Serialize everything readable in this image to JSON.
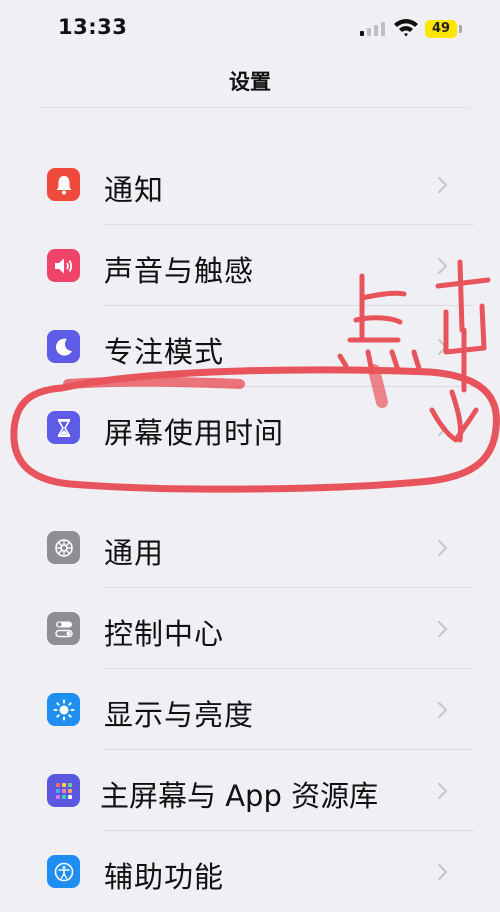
{
  "status_bar": {
    "time": "13:33",
    "battery": "49"
  },
  "nav": {
    "title": "设置"
  },
  "groups": [
    {
      "items": [
        {
          "label": "通知",
          "icon": "bell-icon",
          "color": "#f04a3e"
        },
        {
          "label": "声音与触感",
          "icon": "speaker-icon",
          "color": "#f0436a"
        },
        {
          "label": "专注模式",
          "icon": "moon-icon",
          "color": "#5e5ce6"
        },
        {
          "label": "屏幕使用时间",
          "icon": "hourglass-icon",
          "color": "#5e5ce6"
        }
      ]
    },
    {
      "items": [
        {
          "label": "通用",
          "icon": "gear-icon",
          "color": "#8e8e93"
        },
        {
          "label": "控制中心",
          "icon": "toggles-icon",
          "color": "#8e8e93"
        },
        {
          "label": "显示与亮度",
          "icon": "sun-icon",
          "color": "#1e8ef0"
        },
        {
          "label": "主屏幕与 App 资源库",
          "icon": "app-grid-icon",
          "color": "#5b57e0"
        },
        {
          "label": "辅助功能",
          "icon": "accessibility-icon",
          "color": "#1e8ef0"
        }
      ]
    }
  ],
  "annotation": {
    "text": "点击",
    "color": "#e8474f"
  }
}
